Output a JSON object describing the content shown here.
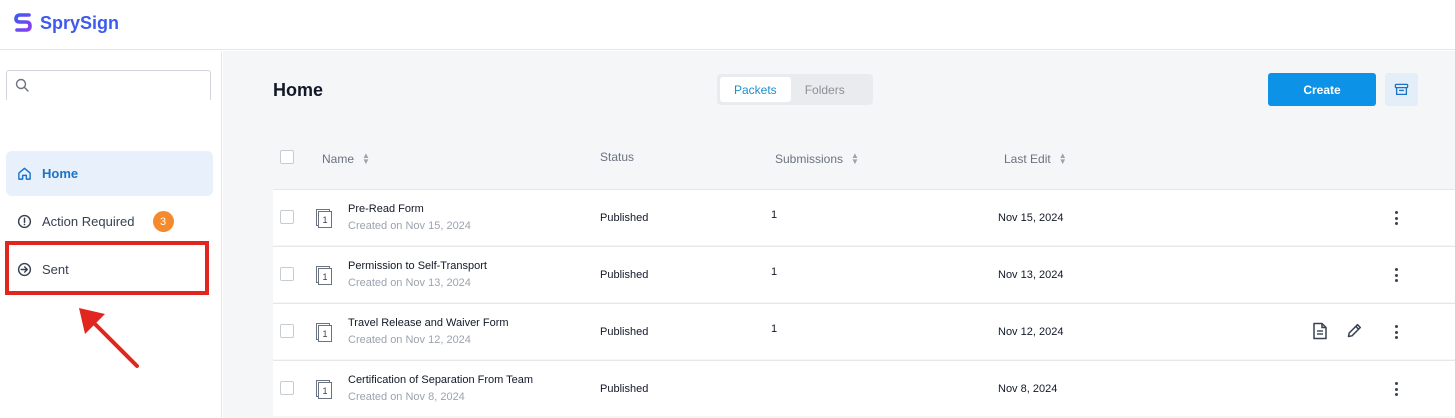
{
  "app": {
    "name": "SprySign",
    "brand_color": "#3d5af1",
    "accent_color": "#0c93e8"
  },
  "sidebar": {
    "search_placeholder": "",
    "items": [
      {
        "label": "Home",
        "icon": "home-icon",
        "active": true
      },
      {
        "label": "Action Required",
        "icon": "alert-circle-icon",
        "badge": "3"
      },
      {
        "label": "Sent",
        "icon": "sent-icon"
      }
    ]
  },
  "header": {
    "title": "Home",
    "tabs": [
      {
        "label": "Packets",
        "active": true
      },
      {
        "label": "Folders"
      }
    ],
    "create_label": "Create",
    "archive_icon": "archive-icon"
  },
  "table": {
    "columns": {
      "name": "Name",
      "status": "Status",
      "submissions": "Submissions",
      "last_edit": "Last Edit"
    },
    "rows": [
      {
        "name": "Pre-Read Form",
        "created": "Created on Nov 15, 2024",
        "status": "Published",
        "submissions": "1",
        "last_edit": "Nov 15, 2024"
      },
      {
        "name": "Permission to Self-Transport",
        "created": "Created on Nov 13, 2024",
        "status": "Published",
        "submissions": "1",
        "last_edit": "Nov 13, 2024"
      },
      {
        "name": "Travel Release and Waiver Form",
        "created": "Created on Nov 12, 2024",
        "status": "Published",
        "submissions": "1",
        "last_edit": "Nov 12, 2024"
      },
      {
        "name": "Certification of Separation From Team",
        "created": "Created on Nov 8, 2024",
        "status": "Published",
        "submissions": "",
        "last_edit": "Nov 8, 2024"
      }
    ]
  }
}
